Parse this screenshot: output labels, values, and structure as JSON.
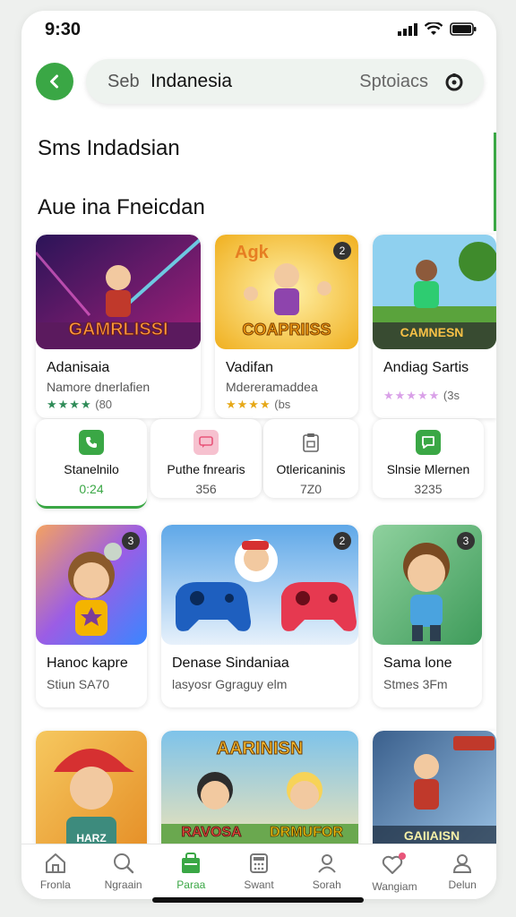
{
  "status": {
    "time": "9:30"
  },
  "search": {
    "prefix": "Seb",
    "value": "Indanesia",
    "option": "Sptoiacs"
  },
  "section_title": "Sms Indadsian",
  "section_subtitle": "Aue ina Fneicdan",
  "featured": [
    {
      "title": "Adanisaia",
      "subtitle": "Namore dnerlafien",
      "stars": "★★★★",
      "rating": "(80",
      "banner": "GAMRLISSI",
      "color_from": "#3b1a6b",
      "color_to": "#c02a8a"
    },
    {
      "title": "Vadifan",
      "subtitle": "Mdereramaddea",
      "stars": "★★★★",
      "rating": "(bs",
      "banner": "COAPRIISS",
      "color_from": "#f2b824",
      "color_to": "#f8d65a",
      "header": "Agk",
      "badge": "2"
    },
    {
      "title": "Andiag Sartis",
      "subtitle": "",
      "stars": "★★★★★",
      "rating": "(3s",
      "banner": "CAMNESN",
      "color_from": "#7fc4e8",
      "color_to": "#5fa844"
    }
  ],
  "stats": [
    {
      "label": "Stanelnilo",
      "value": "0:24",
      "icon": "phone-icon",
      "color": "#3aa745"
    },
    {
      "label": "Puthe fnrearis",
      "value": "356",
      "icon": "chat-icon",
      "color": "#e8557a"
    },
    {
      "label": "Otlericaninis",
      "value": "7Z0",
      "icon": "clipboard-icon",
      "color": "#888888"
    },
    {
      "label": "Slnsie Mlernen",
      "value": "3235",
      "icon": "message-icon",
      "color": "#3aa745"
    }
  ],
  "grid": [
    {
      "title": "Hanoc kapre",
      "subtitle": "Stiun SA70",
      "badge": "3"
    },
    {
      "title": "Denase Sindaniaa",
      "subtitle": "lasyosr Ggraguy elm",
      "badge": "2"
    },
    {
      "title": "Sama lone",
      "subtitle": "Stmes 3Fm",
      "badge": "3"
    }
  ],
  "bottom_cards": [
    {
      "banner": "HARZ"
    },
    {
      "header": "AARINISN",
      "left": "RAVOSA",
      "right": "DRMUFOR"
    },
    {
      "banner": "GAIIAISN"
    }
  ],
  "tabs": [
    {
      "label": "Fronla",
      "icon": "home-icon"
    },
    {
      "label": "Ngraain",
      "icon": "search-icon"
    },
    {
      "label": "Paraa",
      "icon": "bag-icon",
      "active": true
    },
    {
      "label": "Swant",
      "icon": "calculator-icon"
    },
    {
      "label": "Sorah",
      "icon": "profile-icon"
    },
    {
      "label": "Wangiam",
      "icon": "heart-icon"
    },
    {
      "label": "Delun",
      "icon": "user-icon"
    }
  ],
  "colors": {
    "accent": "#3aa745",
    "text": "#111111",
    "muted": "#555555"
  }
}
